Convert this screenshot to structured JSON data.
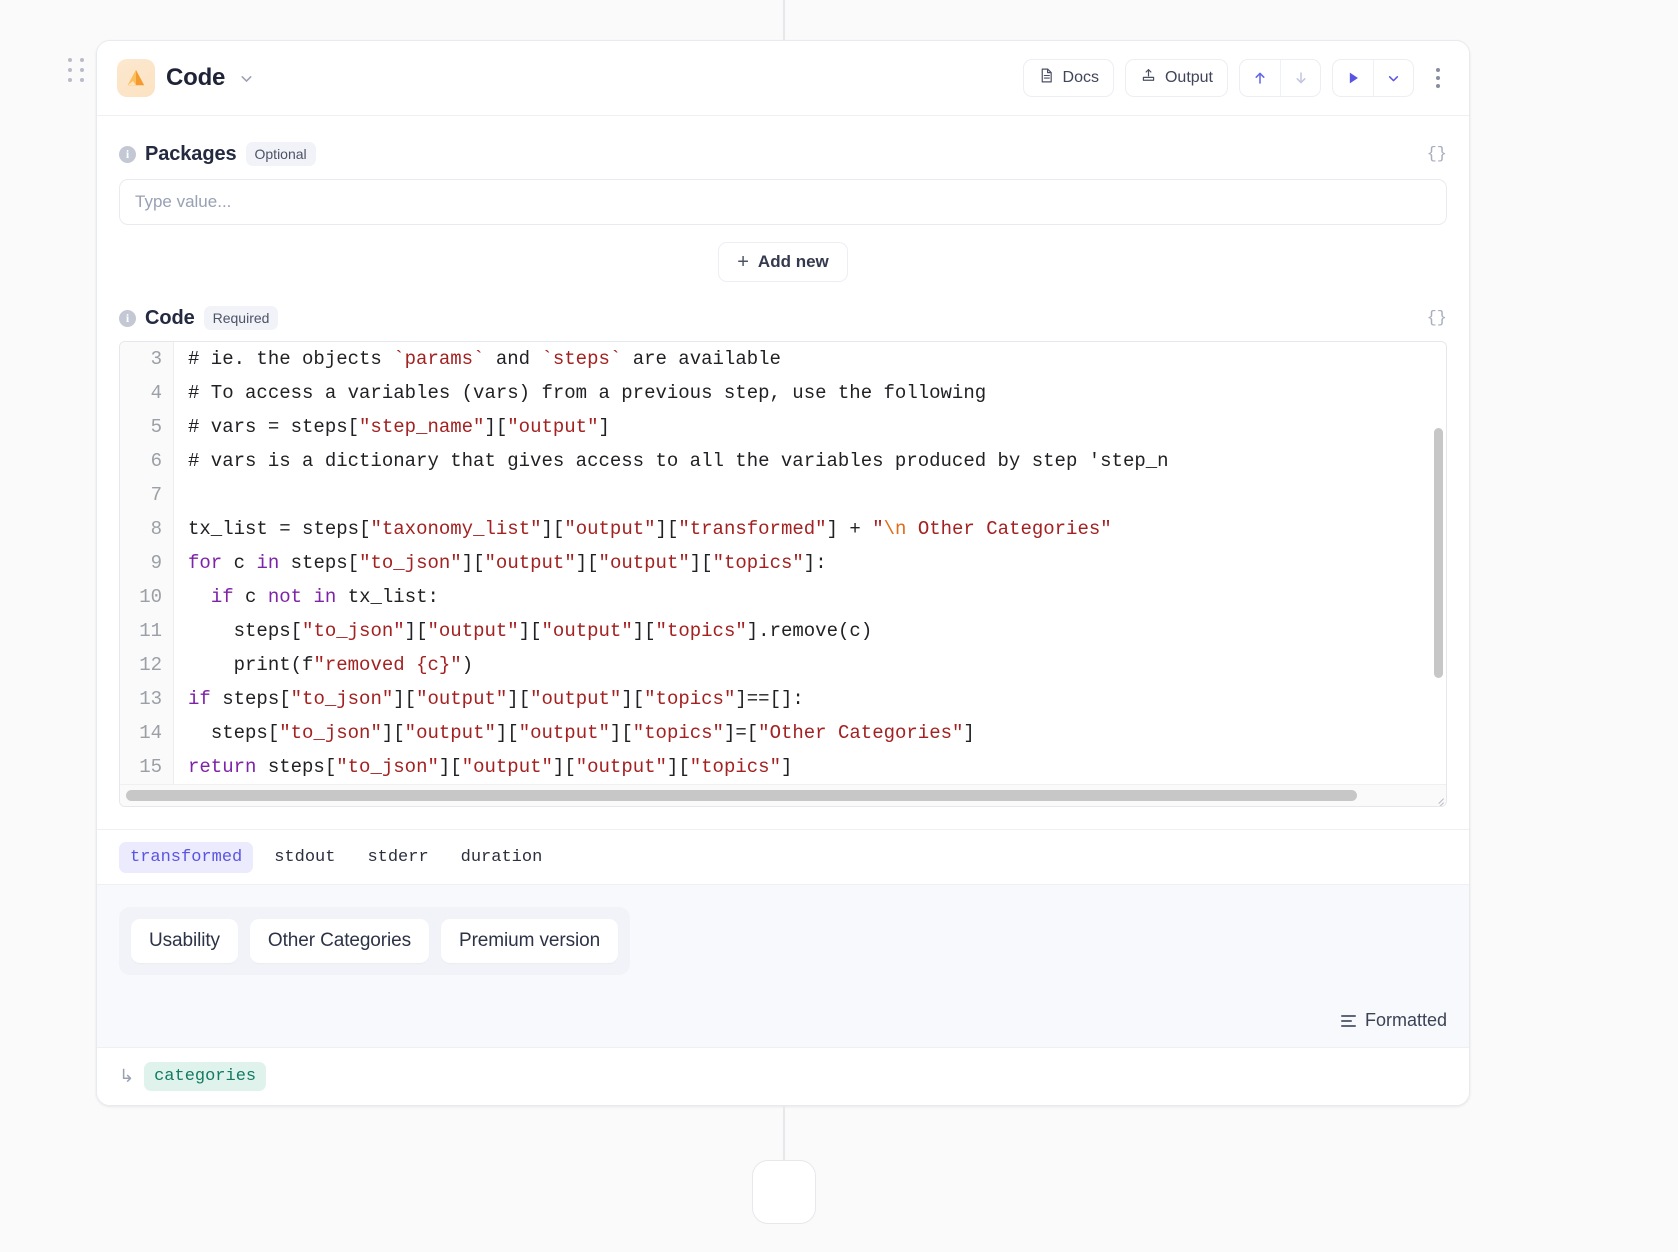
{
  "header": {
    "title": "Code",
    "icon": "orange-triangle-logo-icon",
    "chevron": "chevron-down-icon",
    "docs_label": "Docs",
    "output_label": "Output",
    "move_up_icon": "arrow-up-icon",
    "move_down_icon": "arrow-down-icon",
    "run_icon": "play-icon",
    "run_chevron_icon": "chevron-down-icon",
    "more_icon": "kebab-menu-icon"
  },
  "packages": {
    "label": "Packages",
    "badge": "Optional",
    "braces": "{}",
    "input_placeholder": "Type value...",
    "input_value": "",
    "add_new_label": "Add new",
    "add_new_plus": "+"
  },
  "code_field": {
    "label": "Code",
    "badge": "Required",
    "braces": "{}"
  },
  "editor": {
    "line_numbers": [
      "3",
      "4",
      "5",
      "6",
      "7",
      "8",
      "9",
      "10",
      "11",
      "12",
      "13",
      "14",
      "15"
    ],
    "lines": [
      "# ie. the objects `params` and `steps` are available",
      "# To access a variables (vars) from a previous step, use the following",
      "# vars = steps[\"step_name\"][\"output\"]",
      "# vars is a dictionary that gives access to all the variables produced by step 'step_n",
      "",
      "tx_list = steps[\"taxonomy_list\"][\"output\"][\"transformed\"] + \"\\n Other Categories\"",
      "for c in steps[\"to_json\"][\"output\"][\"output\"][\"topics\"]:",
      "  if c not in tx_list:",
      "    steps[\"to_json\"][\"output\"][\"output\"][\"topics\"].remove(c)",
      "    print(f\"removed {c}\")",
      "if steps[\"to_json\"][\"output\"][\"output\"][\"topics\"]==[]:",
      "  steps[\"to_json\"][\"output\"][\"output\"][\"topics\"]=[\"Other Categories\"]",
      "return steps[\"to_json\"][\"output\"][\"output\"][\"topics\"]"
    ]
  },
  "output_tabs": [
    {
      "label": "transformed",
      "active": true
    },
    {
      "label": "stdout",
      "active": false
    },
    {
      "label": "stderr",
      "active": false
    },
    {
      "label": "duration",
      "active": false
    }
  ],
  "result": {
    "chips": [
      "Usability",
      "Other Categories",
      "Premium version"
    ],
    "formatted_label": "Formatted",
    "formatted_icon": "list-lines-icon"
  },
  "footer": {
    "arrow": "↳",
    "variable": "categories"
  },
  "colors": {
    "accent": "#5a55e0",
    "keyword": "#7e22a8",
    "string": "#a32121",
    "escape": "#e06c17",
    "var_chip_text": "#137a63",
    "var_chip_bg": "#dff3ec"
  }
}
